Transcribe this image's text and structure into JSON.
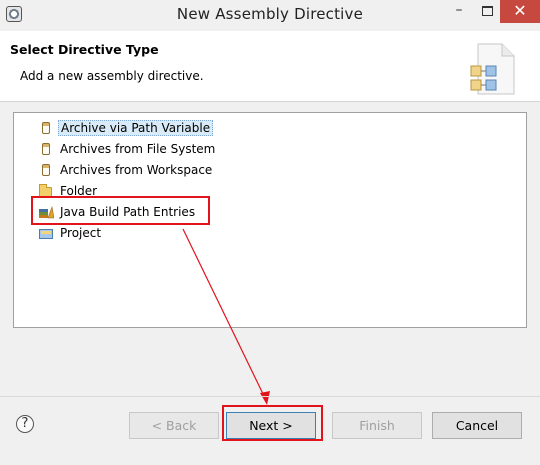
{
  "window": {
    "title": "New Assembly Directive",
    "minimize_glyph": "–",
    "close_glyph": "✕"
  },
  "header": {
    "title": "Select Directive Type",
    "description": "Add a new assembly directive."
  },
  "tree": {
    "items": [
      {
        "label": "Archive via Path Variable",
        "icon": "jar-icon",
        "selected": true
      },
      {
        "label": "Archives from File System",
        "icon": "jar-icon",
        "selected": false
      },
      {
        "label": "Archives from Workspace",
        "icon": "jar-icon",
        "selected": false
      },
      {
        "label": "Folder",
        "icon": "folder-icon",
        "selected": false
      },
      {
        "label": "Java Build Path Entries",
        "icon": "java-library-icon",
        "selected": false
      },
      {
        "label": "Project",
        "icon": "project-folder-icon",
        "selected": false
      }
    ]
  },
  "buttons": {
    "help": "?",
    "back": "< Back",
    "next": "Next >",
    "finish": "Finish",
    "cancel": "Cancel"
  },
  "colors": {
    "annotation": "#e1141c",
    "close_button": "#c7483f",
    "selection": "#d9ebf9"
  }
}
